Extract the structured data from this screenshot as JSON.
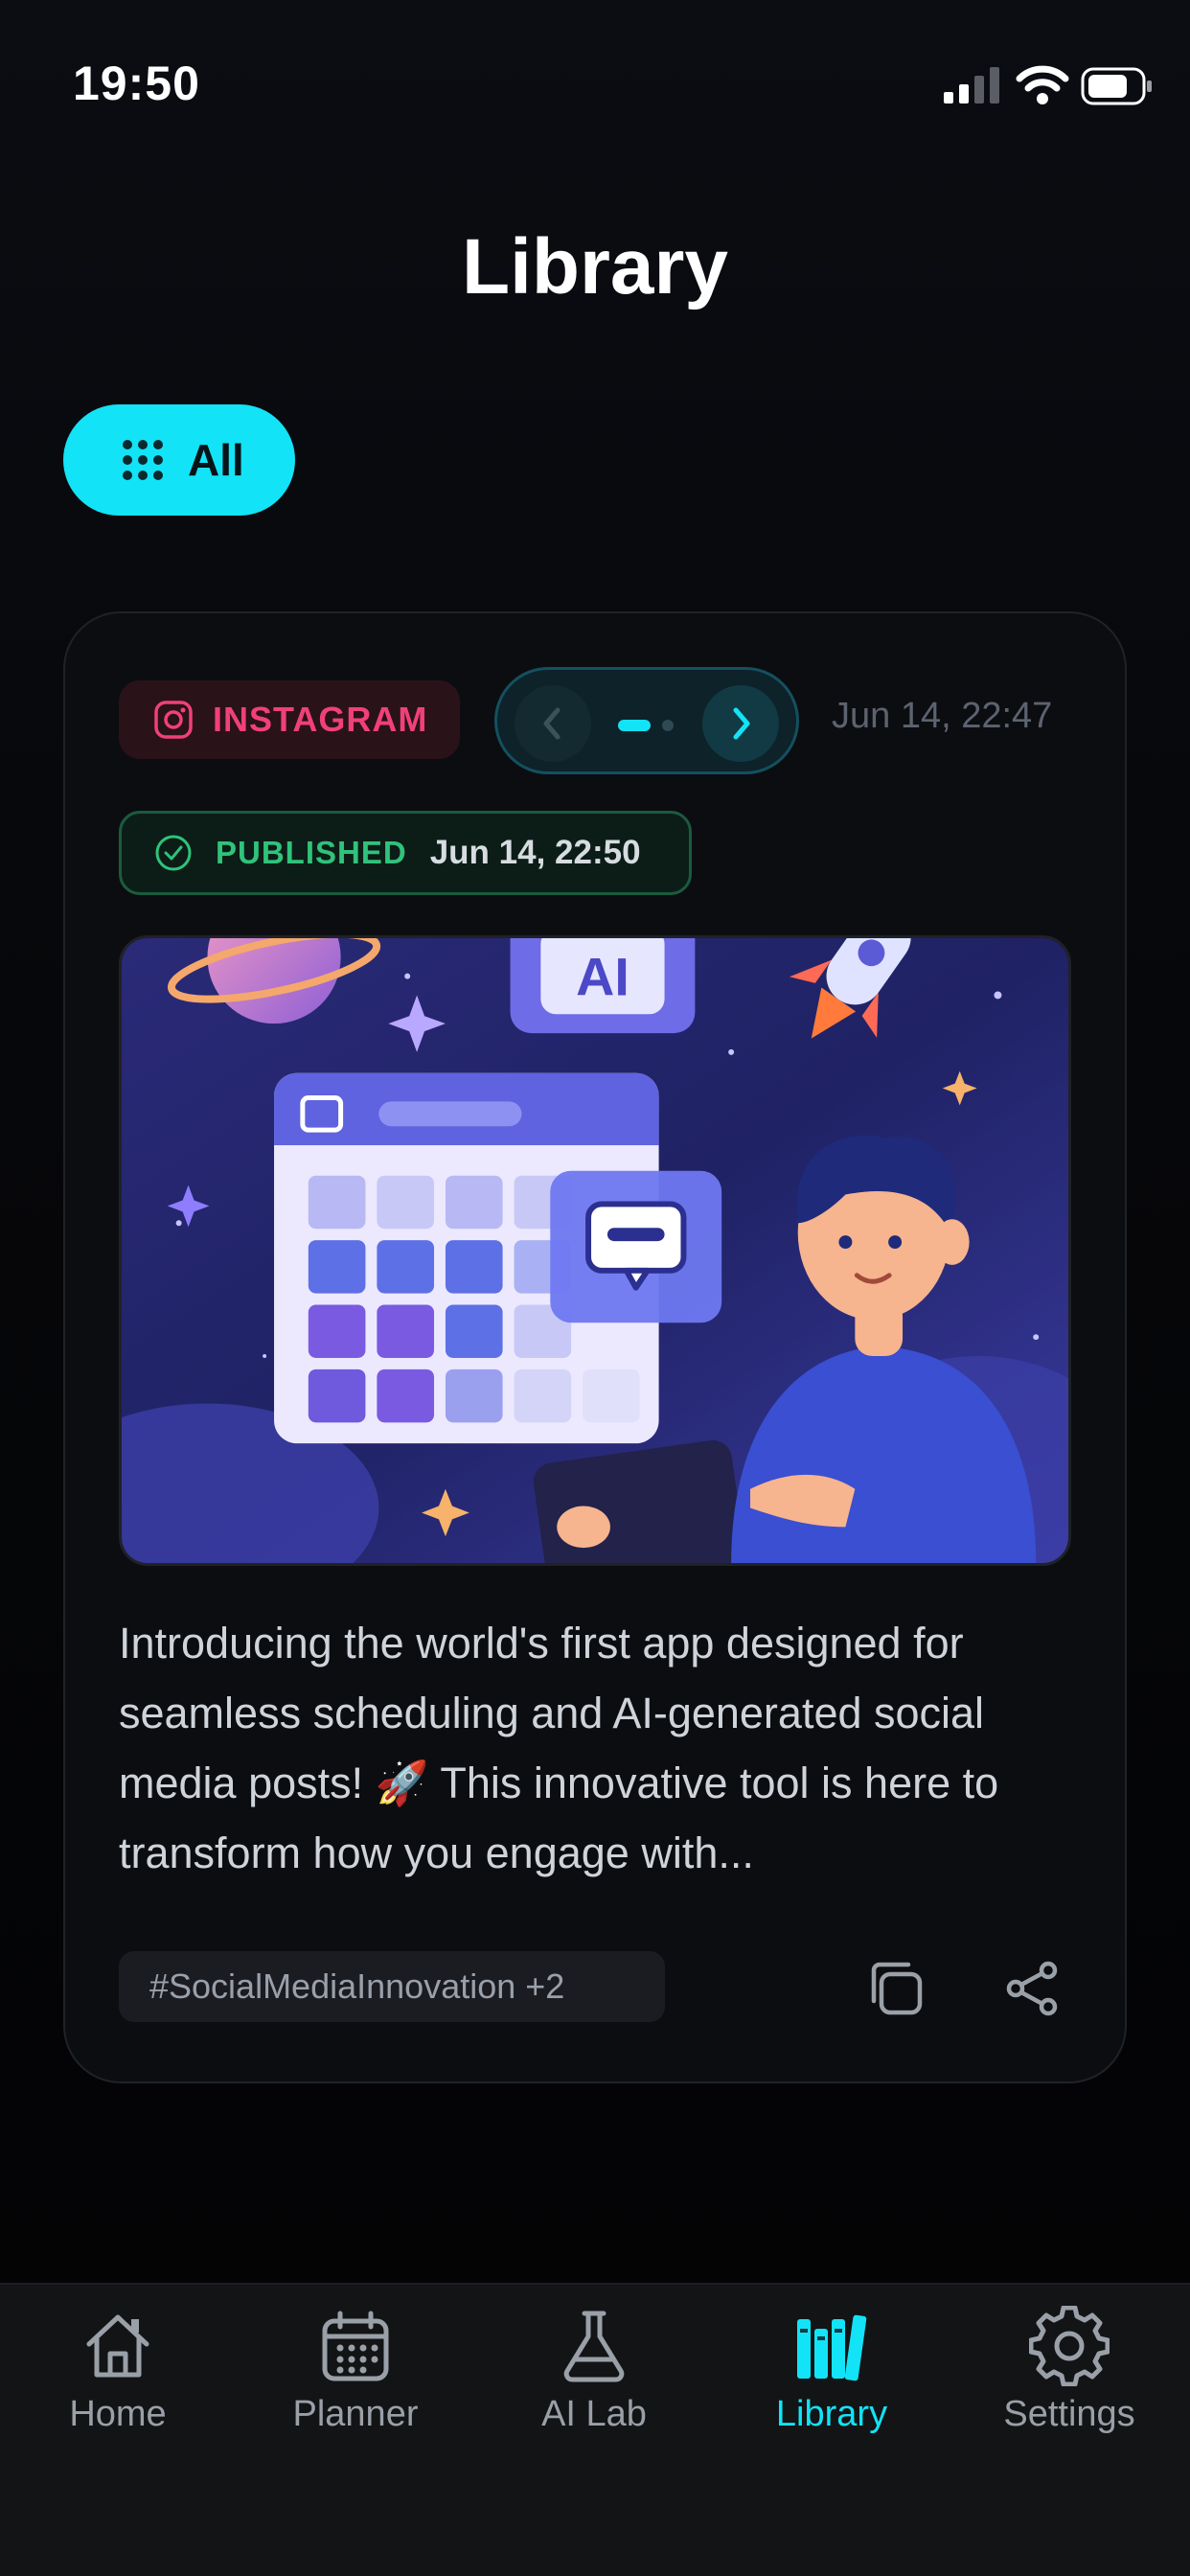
{
  "status_bar": {
    "time": "19:50"
  },
  "page": {
    "title": "Library"
  },
  "filter": {
    "label": "All"
  },
  "post": {
    "platform": "INSTAGRAM",
    "created_at": "Jun 14, 22:47",
    "status_label": "PUBLISHED",
    "status_time": "Jun 14, 22:50",
    "image_text": "AI",
    "caption": "Introducing the world's first app designed for seamless scheduling and AI-generated social media posts! 🚀 This innovative tool is here to transform how you engage with...",
    "hashtags": "#SocialMediaInnovation +2",
    "pager": {
      "pages": 2,
      "current": 1
    }
  },
  "tabs": [
    {
      "label": "Home",
      "icon": "home-icon",
      "active": false
    },
    {
      "label": "Planner",
      "icon": "calendar-icon",
      "active": false
    },
    {
      "label": "AI Lab",
      "icon": "flask-icon",
      "active": false
    },
    {
      "label": "Library",
      "icon": "library-icon",
      "active": true
    },
    {
      "label": "Settings",
      "icon": "gear-icon",
      "active": false
    }
  ],
  "colors": {
    "accent": "#13e3f6",
    "instagram": "#f0407a",
    "published": "#2fc37b",
    "background": "#06070a"
  }
}
